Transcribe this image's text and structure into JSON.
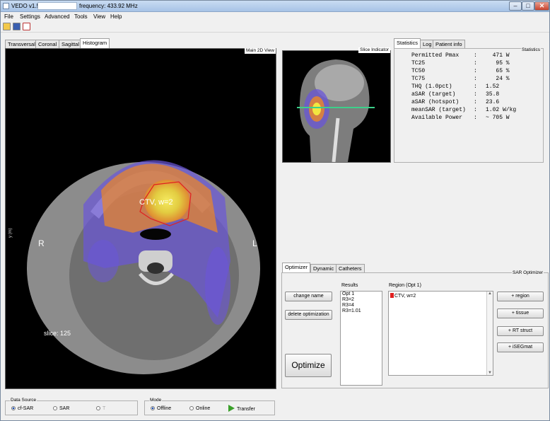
{
  "titlebar": {
    "app_title": "VEDO v1.5,",
    "frequency": "frequency: 433.92 MHz",
    "minimize": "–",
    "maximize": "□",
    "close": "✕"
  },
  "menu": [
    "File",
    "Settings",
    "Advanced",
    "Tools",
    "View",
    "Help"
  ],
  "toolbar": {
    "icons": [
      "open-folder-icon",
      "save-icon",
      "pdf-icon"
    ]
  },
  "view_tabs": [
    "Transversal",
    "Coronal",
    "Sagittal",
    "Histogram"
  ],
  "main_view": {
    "title": "Main 2D View",
    "axis_label": "y (m)",
    "label_right": "R",
    "label_left": "L",
    "contour_label": "CTV, w=2",
    "slice_text": "slice: 125"
  },
  "slice_indicator": {
    "title": "Slice Indicator"
  },
  "stats_tabs": [
    "Statistics",
    "Log",
    "Patient info"
  ],
  "statistics": {
    "title": "Statistics",
    "rows": [
      {
        "key": "Permitted Pmax",
        "value": "  471 W"
      },
      {
        "key": "TC25",
        "value": "   95 %"
      },
      {
        "key": "TC50",
        "value": "   65 %"
      },
      {
        "key": "TC75",
        "value": "   24 %"
      },
      {
        "key": "THQ (1.0pct)",
        "value": "1.52"
      },
      {
        "key": "aSAR (target)",
        "value": "35.8"
      },
      {
        "key": "aSAR (hotspot)",
        "value": "23.6"
      },
      {
        "key": "meanSAR (target)",
        "value": "1.02 W/kg"
      },
      {
        "key": "Available Power",
        "value": "~ 705 W"
      }
    ]
  },
  "optimizer_tabs": [
    "Optimizer",
    "Dynamic",
    "Catheters"
  ],
  "optimizer": {
    "title": "SAR Optimizer",
    "change_name": "change name",
    "delete_optimization": "delete optimization",
    "optimize": "Optimize",
    "results_label": "Results",
    "results": [
      "Opt 1",
      "R3=2",
      "R3=4",
      "R3=1.01"
    ],
    "region_label": "Region (Opt 1)",
    "region_items": [
      "CTV, w=2"
    ],
    "region_button": "+ region",
    "tissue_button": "+ tissue",
    "rtstruct_button": "+ RT struct",
    "isegmat_button": "+ iSEGmat"
  },
  "data_source": {
    "title": "Data Source",
    "options": [
      "cf-SAR",
      "SAR",
      "T"
    ],
    "selected": "cf-SAR"
  },
  "mode": {
    "title": "Mode",
    "options": [
      "Offline",
      "Online"
    ],
    "selected": "Offline",
    "transfer": "Transfer"
  },
  "colors": {
    "ctv_contour": "#e02020",
    "slice_line": "#3cd08a",
    "sar_hot": "#f2e640",
    "sar_mid": "#e7862d",
    "sar_low": "#6a55d8"
  }
}
